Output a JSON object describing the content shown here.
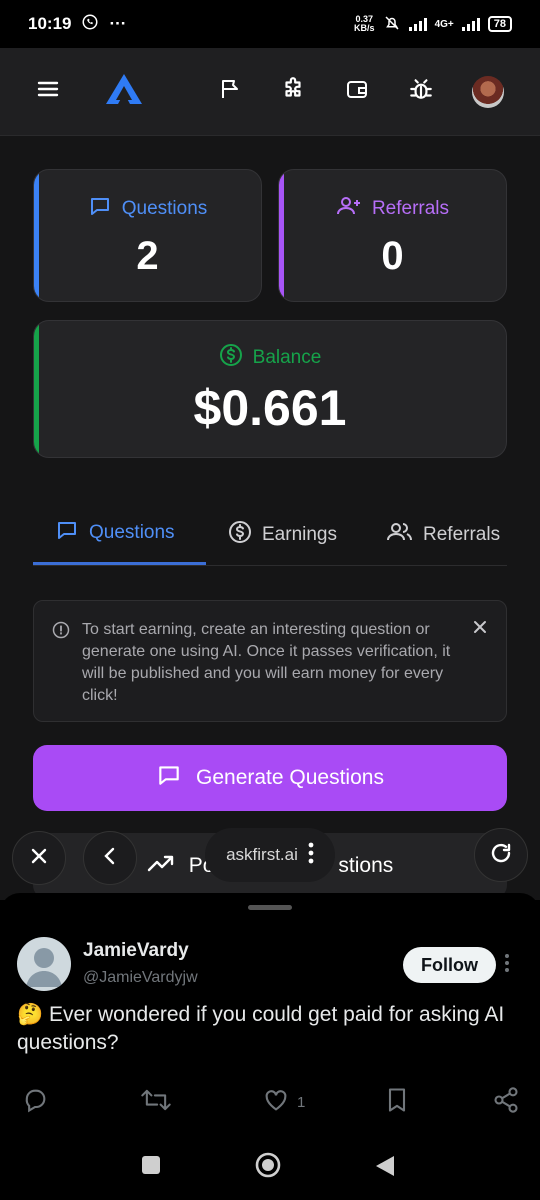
{
  "status_bar": {
    "time": "10:19",
    "speed_top": "0.37",
    "speed_bottom": "KB/s",
    "network": "4G+",
    "battery": "78",
    "more": "···"
  },
  "header": {
    "icons": [
      "menu-icon",
      "logo-icon",
      "flag-icon",
      "puzzle-icon",
      "wallet-icon",
      "bug-icon",
      "avatar"
    ]
  },
  "stats": {
    "questions_label": "Questions",
    "questions_value": "2",
    "referrals_label": "Referrals",
    "referrals_value": "0",
    "balance_label": "Balance",
    "balance_value": "$0.661"
  },
  "tabs": [
    {
      "label": "Questions",
      "active": true
    },
    {
      "label": "Earnings",
      "active": false
    },
    {
      "label": "Referrals",
      "active": false
    }
  ],
  "notice": {
    "text": "To start earning, create an interesting question or generate one using AI. Once it passes verification, it will be published and you will earn money for every click!"
  },
  "buttons": {
    "generate": "Generate Questions",
    "popular_prefix": "Po",
    "popular_suffix": "stions"
  },
  "browser": {
    "url": "askfirst.ai"
  },
  "tweet": {
    "name": "JamieVardy",
    "handle": "@JamieVardyjw",
    "follow_label": "Follow",
    "text": "🤔 Ever wondered if you could get paid for asking AI questions?",
    "like_count": "1"
  },
  "colors": {
    "accent_blue": "#3b82f6",
    "accent_purple": "#a855f7",
    "accent_green": "#16a34a",
    "button_purple": "#a94bf5"
  }
}
